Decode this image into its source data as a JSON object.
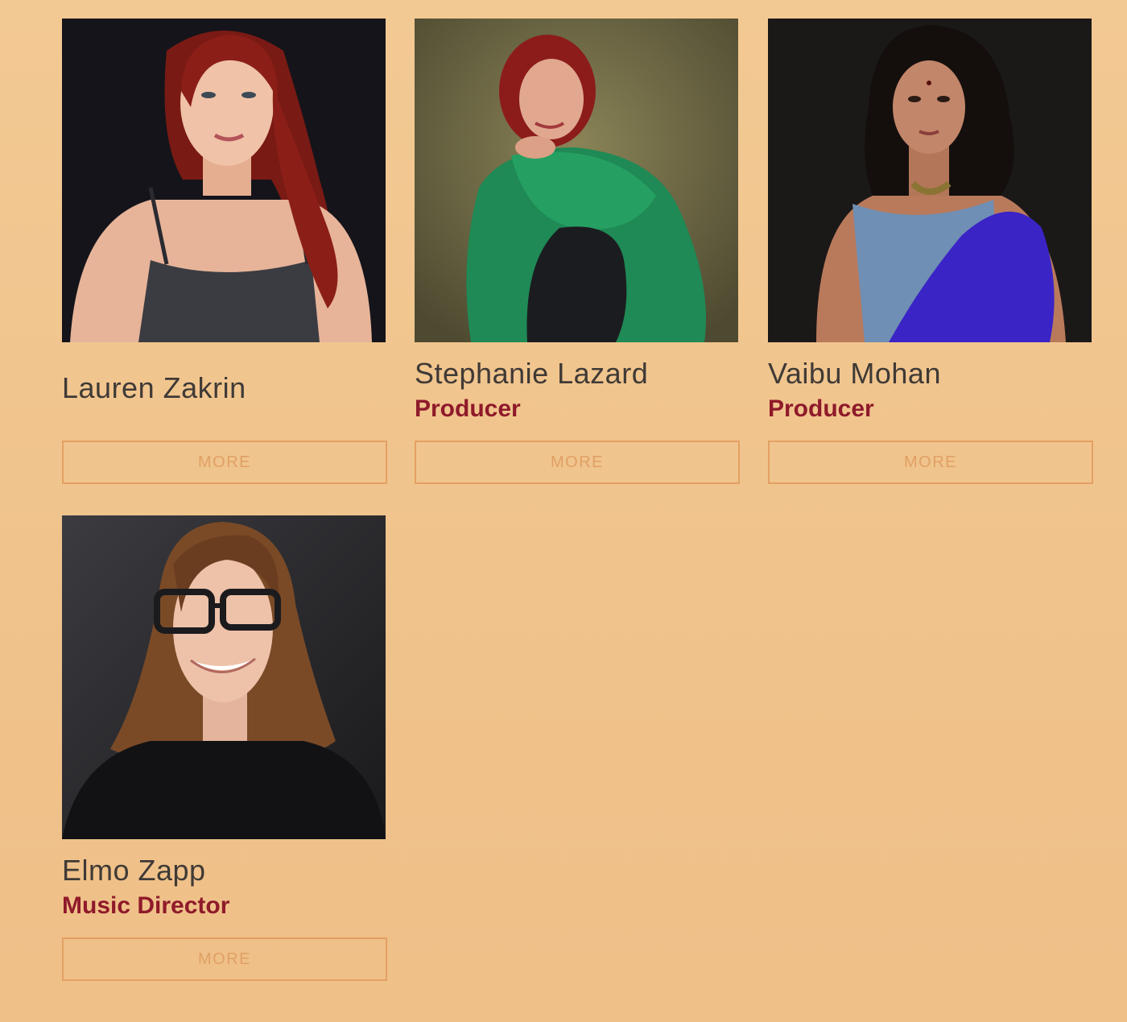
{
  "members": [
    {
      "name": "Lauren Zakrin",
      "role": "",
      "more_label": "MORE",
      "photo_icon": "portrait-photo"
    },
    {
      "name": "Stephanie Lazard",
      "role": "Producer",
      "more_label": "MORE",
      "photo_icon": "portrait-photo"
    },
    {
      "name": "Vaibu Mohan",
      "role": "Producer",
      "more_label": "MORE",
      "photo_icon": "portrait-photo"
    },
    {
      "name": "Elmo Zapp",
      "role": "Music Director",
      "more_label": "MORE",
      "photo_icon": "portrait-photo"
    }
  ],
  "colors": {
    "background": "#f1c48d",
    "name_text": "#3f3a36",
    "role_text": "#8f1a2a",
    "button_border": "#e3a063",
    "button_text": "#e0a065"
  }
}
